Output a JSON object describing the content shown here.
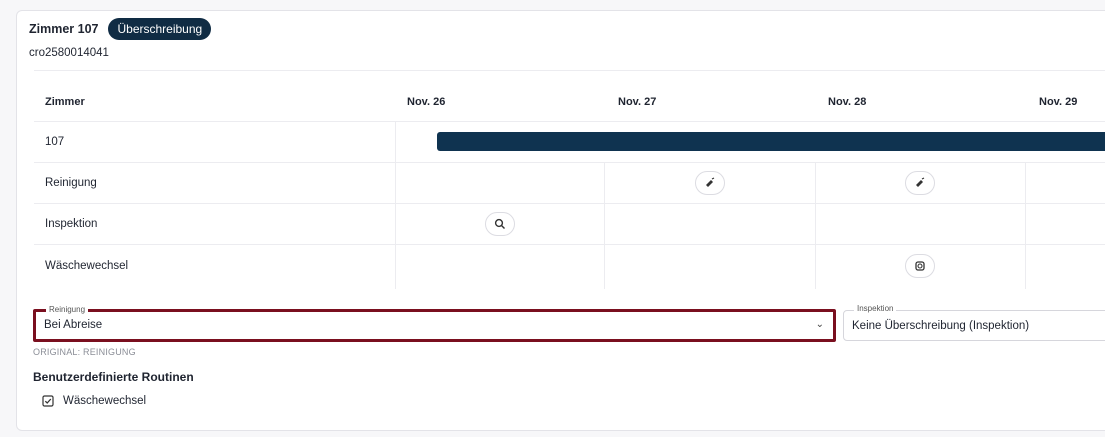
{
  "header": {
    "room_title": "Zimmer 107",
    "badge": "Überschreibung",
    "room_code": "cro2580014041"
  },
  "grid": {
    "column_header": "Zimmer",
    "dates": [
      "Nov. 26",
      "Nov. 27",
      "Nov. 28",
      "Nov. 29"
    ],
    "rows": [
      {
        "label": "107"
      },
      {
        "label": "Reinigung"
      },
      {
        "label": "Inspektion"
      },
      {
        "label": "Wäschewechsel"
      }
    ]
  },
  "fields": {
    "reinigung": {
      "legend": "Reinigung",
      "value": "Bei Abreise"
    },
    "inspektion": {
      "legend": "Inspektion",
      "value": "Keine Überschreibung (Inspektion)"
    }
  },
  "original_note": "ORIGINAL: REINIGUNG",
  "routines": {
    "title": "Benutzerdefinierte Routinen",
    "items": [
      {
        "label": "Wäschewechsel",
        "checked": true
      }
    ]
  },
  "colors": {
    "badge": "#102c44",
    "booking_bar": "#0f3350",
    "focus_border": "#7a0f1f"
  },
  "icons": {
    "cleaning": "broom-icon",
    "inspection": "search-icon",
    "linen": "linen-change-icon",
    "dropdown": "chevron-down-icon",
    "checkbox": "checkbox-checked-icon"
  }
}
